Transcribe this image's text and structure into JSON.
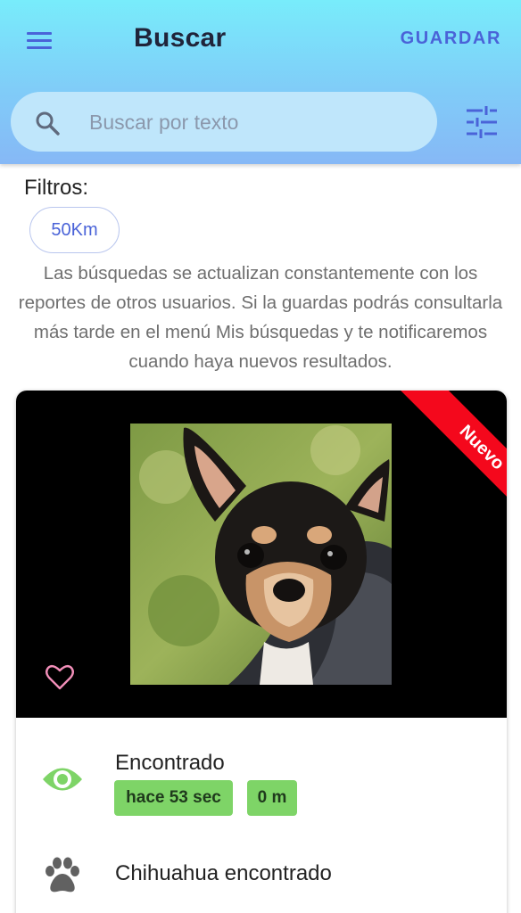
{
  "header": {
    "title": "Buscar",
    "save_label": "GUARDAR",
    "menu_icon": "hamburger-menu-icon",
    "filter_icon": "tune-sliders-icon",
    "gradient_top": "#78ecfb",
    "gradient_bottom": "#86b8f6",
    "accent": "#4a63d8"
  },
  "search": {
    "placeholder": "Buscar por texto",
    "value": "",
    "icon": "search-icon"
  },
  "filters": {
    "label": "Filtros:",
    "chips": [
      {
        "label": "50Km"
      }
    ]
  },
  "info_text": "Las búsquedas se actualizan constantemente con los reportes de otros usuarios. Si la guardas podrás consultarla más tarde en el menú Mis búsquedas y te notificaremos cuando haya nuevos resultados.",
  "results": [
    {
      "ribbon": "Nuevo",
      "ribbon_color": "#f4081c",
      "favorite_icon": "heart-outline-icon",
      "status_icon": "eye-icon",
      "status_color": "#7ed467",
      "status": "Encontrado",
      "time_badge": "hace 53 sec",
      "distance_badge": "0 m",
      "breed_icon": "paw-icon",
      "title": "Chihuahua encontrado"
    }
  ]
}
